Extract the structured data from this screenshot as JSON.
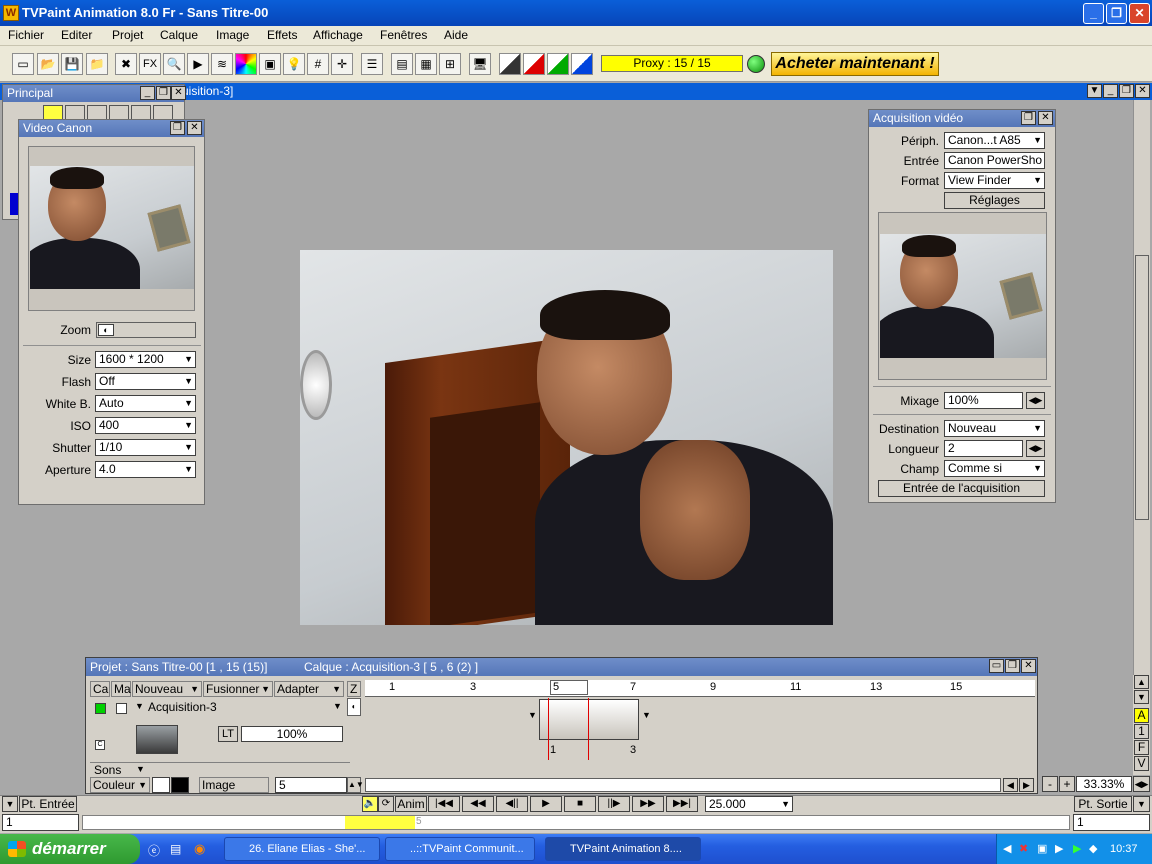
{
  "window": {
    "title": "TVPaint Animation 8.0 Fr - Sans Titre-00"
  },
  "menu": [
    "Fichier",
    "Editer",
    "Projet",
    "Calque",
    "Image",
    "Effets",
    "Affichage",
    "Fenêtres",
    "Aide"
  ],
  "toolbar": {
    "proxy": "Proxy : 15 / 15",
    "buy": "Acheter maintenant !",
    "fx": "FX"
  },
  "docbar": {
    "title": "uisition-3]"
  },
  "principal": {
    "title": "Principal"
  },
  "video_canon": {
    "title": "Video Canon",
    "zoom_label": "Zoom",
    "fields": [
      {
        "label": "Size",
        "value": "1600 * 1200"
      },
      {
        "label": "Flash",
        "value": "Off"
      },
      {
        "label": "White B.",
        "value": "Auto"
      },
      {
        "label": "ISO",
        "value": "400"
      },
      {
        "label": "Shutter",
        "value": "1/10"
      },
      {
        "label": "Aperture",
        "value": "4.0"
      }
    ]
  },
  "acquisition": {
    "title": "Acquisition vidéo",
    "periph_label": "Périph.",
    "periph": "Canon...t A85",
    "entree_label": "Entrée",
    "entree": "Canon PowerSho",
    "format_label": "Format",
    "format": "View Finder",
    "reglages": "Réglages",
    "mixage_label": "Mixage",
    "mixage": "100%",
    "destination_label": "Destination",
    "destination": "Nouveau",
    "longueur_label": "Longueur",
    "longueur": "2",
    "champ_label": "Champ",
    "champ": "Comme si",
    "entree_acq": "Entrée de l'acquisition"
  },
  "timeline": {
    "project": "Projet : Sans Titre-00 [1 , 15  (15)]",
    "layer_info": "Calque : Acquisition-3 [ 5 , 6  (2) ]",
    "col_ca": "Ca",
    "col_ma": "Ma",
    "nouveau": "Nouveau",
    "fusionner": "Fusionner",
    "adapter": "Adapter",
    "z": "Z",
    "layer_name": "Acquisition-3",
    "lt": "LT",
    "opacity": "100%",
    "c": "C",
    "sons": "Sons",
    "couleur": "Couleur",
    "image_label": "Image",
    "image_value": "5",
    "ruler": [
      "1",
      "3",
      "5",
      "7",
      "9",
      "11",
      "13",
      "15"
    ],
    "frame_first": "1",
    "frame_last": "3",
    "zoom": "33.33%",
    "minus": "-",
    "plus": "+",
    "side": [
      "A",
      "1",
      "F",
      "V"
    ]
  },
  "transport": {
    "pt_entree": "Pt. Entrée",
    "anim": "Anim",
    "fps": "25.000",
    "pt_sortie": "Pt. Sortie",
    "in_val": "1",
    "out_val": "1",
    "cursor": "5"
  },
  "taskbar": {
    "start": "démarrer",
    "tasks": [
      "26. Eliane Elias - She'...",
      "..::TVPaint Communit...",
      "TVPaint Animation 8...."
    ],
    "clock": "10:37"
  },
  "colors": {
    "titlebar": "#0a5fd8",
    "panel": "#d4d0c8",
    "proxy": "#ffff00",
    "taskbar": "#245ee0",
    "start": "#2f9a30"
  }
}
